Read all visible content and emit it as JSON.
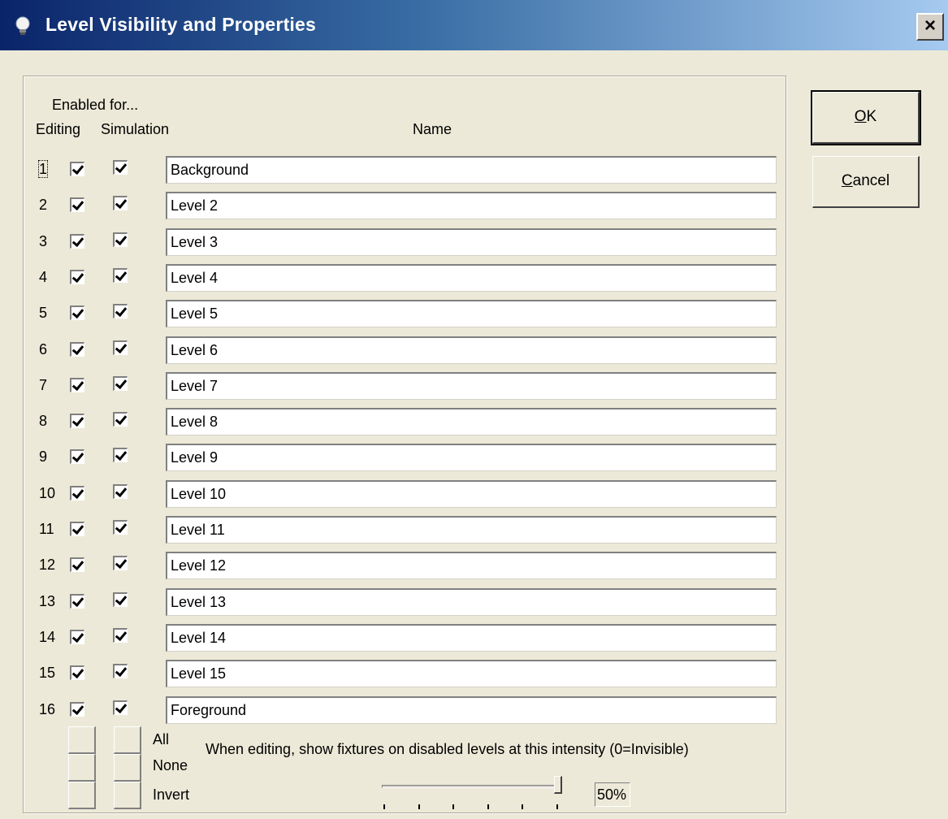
{
  "window": {
    "title": "Level Visibility and Properties",
    "close_label": "×"
  },
  "headers": {
    "enabled_for": "Enabled for...",
    "editing": "Editing",
    "simulation": "Simulation",
    "name": "Name"
  },
  "levels": [
    {
      "num": "1",
      "editing": true,
      "simulation": true,
      "name": "Background"
    },
    {
      "num": "2",
      "editing": true,
      "simulation": true,
      "name": "Level 2"
    },
    {
      "num": "3",
      "editing": true,
      "simulation": true,
      "name": "Level 3"
    },
    {
      "num": "4",
      "editing": true,
      "simulation": true,
      "name": "Level 4"
    },
    {
      "num": "5",
      "editing": true,
      "simulation": true,
      "name": "Level 5"
    },
    {
      "num": "6",
      "editing": true,
      "simulation": true,
      "name": "Level 6"
    },
    {
      "num": "7",
      "editing": true,
      "simulation": true,
      "name": "Level 7"
    },
    {
      "num": "8",
      "editing": true,
      "simulation": true,
      "name": "Level 8"
    },
    {
      "num": "9",
      "editing": true,
      "simulation": true,
      "name": "Level 9"
    },
    {
      "num": "10",
      "editing": true,
      "simulation": true,
      "name": "Level 10"
    },
    {
      "num": "11",
      "editing": true,
      "simulation": true,
      "name": "Level 11"
    },
    {
      "num": "12",
      "editing": true,
      "simulation": true,
      "name": "Level 12"
    },
    {
      "num": "13",
      "editing": true,
      "simulation": true,
      "name": "Level 13"
    },
    {
      "num": "14",
      "editing": true,
      "simulation": true,
      "name": "Level 14"
    },
    {
      "num": "15",
      "editing": true,
      "simulation": true,
      "name": "Level 15"
    },
    {
      "num": "16",
      "editing": true,
      "simulation": true,
      "name": "Foreground"
    }
  ],
  "bulk": {
    "all": "All",
    "none": "None",
    "invert": "Invert"
  },
  "intensity": {
    "note": "When editing, show fixtures on disabled levels at this intensity (0=Invisible)",
    "value_label": "50%",
    "slider_fraction": 1.0
  },
  "buttons": {
    "ok_mnemonic": "O",
    "ok_rest": "K",
    "cancel_mnemonic": "C",
    "cancel_rest": "ancel"
  },
  "colors": {
    "titlebar_start": "#0a246a",
    "titlebar_end": "#a6caf0",
    "dialog_bg": "#ece9d8"
  }
}
